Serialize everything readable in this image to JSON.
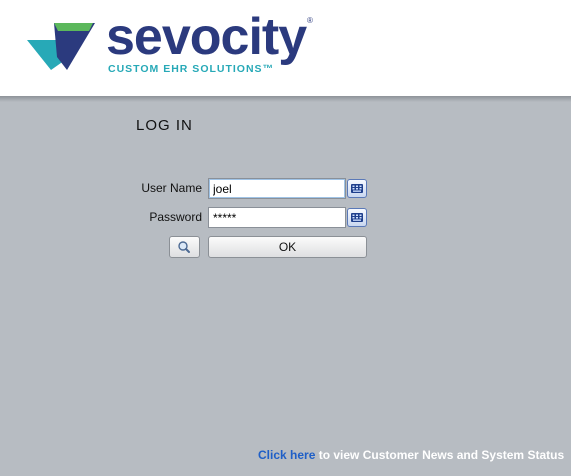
{
  "brand": {
    "name": "sevocity",
    "registered_mark": "®",
    "tagline": "CUSTOM EHR SOLUTIONS™",
    "colors": {
      "navy": "#2b3a7e",
      "teal": "#27a9b7",
      "green": "#5cb85c"
    }
  },
  "login": {
    "title": "LOG IN",
    "username_label": "User Name",
    "username_value": "joel",
    "password_label": "Password",
    "password_value": "*****",
    "keyboard_icon": "keyboard-icon",
    "search_icon": "magnifier-icon",
    "ok_label": "OK"
  },
  "footer": {
    "link_text": "Click here",
    "message": " to view Customer News and System Status"
  }
}
